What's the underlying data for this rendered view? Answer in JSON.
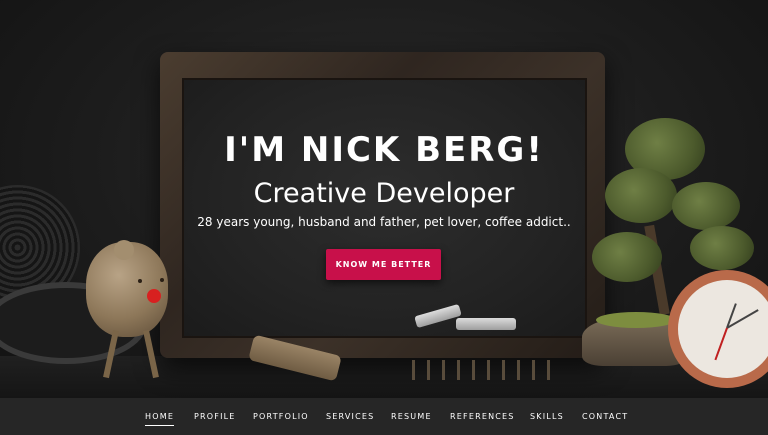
{
  "hero": {
    "headline": "I'M NICK BERG!",
    "subheadline": "Creative Developer",
    "tagline": "28 years young, husband and father, pet lover, coffee addict..",
    "cta_label": "KNOW ME BETTER",
    "accent_color": "#c8104a"
  },
  "nav": {
    "active_item": "HOME",
    "items": [
      {
        "label": "HOME"
      },
      {
        "label": "PROFILE"
      },
      {
        "label": "PORTFOLIO"
      },
      {
        "label": "SERVICES"
      },
      {
        "label": "RESUME"
      },
      {
        "label": "REFERENCES"
      },
      {
        "label": "SKILLS"
      },
      {
        "label": "CONTACT"
      }
    ]
  }
}
